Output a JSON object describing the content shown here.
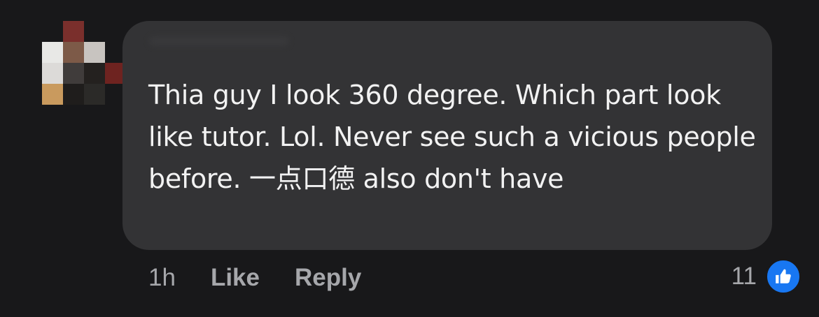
{
  "comment": {
    "text": "Thia guy I look 360 degree. Which part look like tutor. Lol. Never see such a vicious people before. 一点口德 also don't have"
  },
  "meta": {
    "time": "1h",
    "like_label": "Like",
    "reply_label": "Reply"
  },
  "reactions": {
    "count": "11",
    "icon": "thumbs-up-icon"
  },
  "colors": {
    "background": "#18181a",
    "bubble": "#333335",
    "text": "#f2f2f2",
    "meta_text": "#a6a7ab",
    "like_blue": "#1877f2"
  }
}
